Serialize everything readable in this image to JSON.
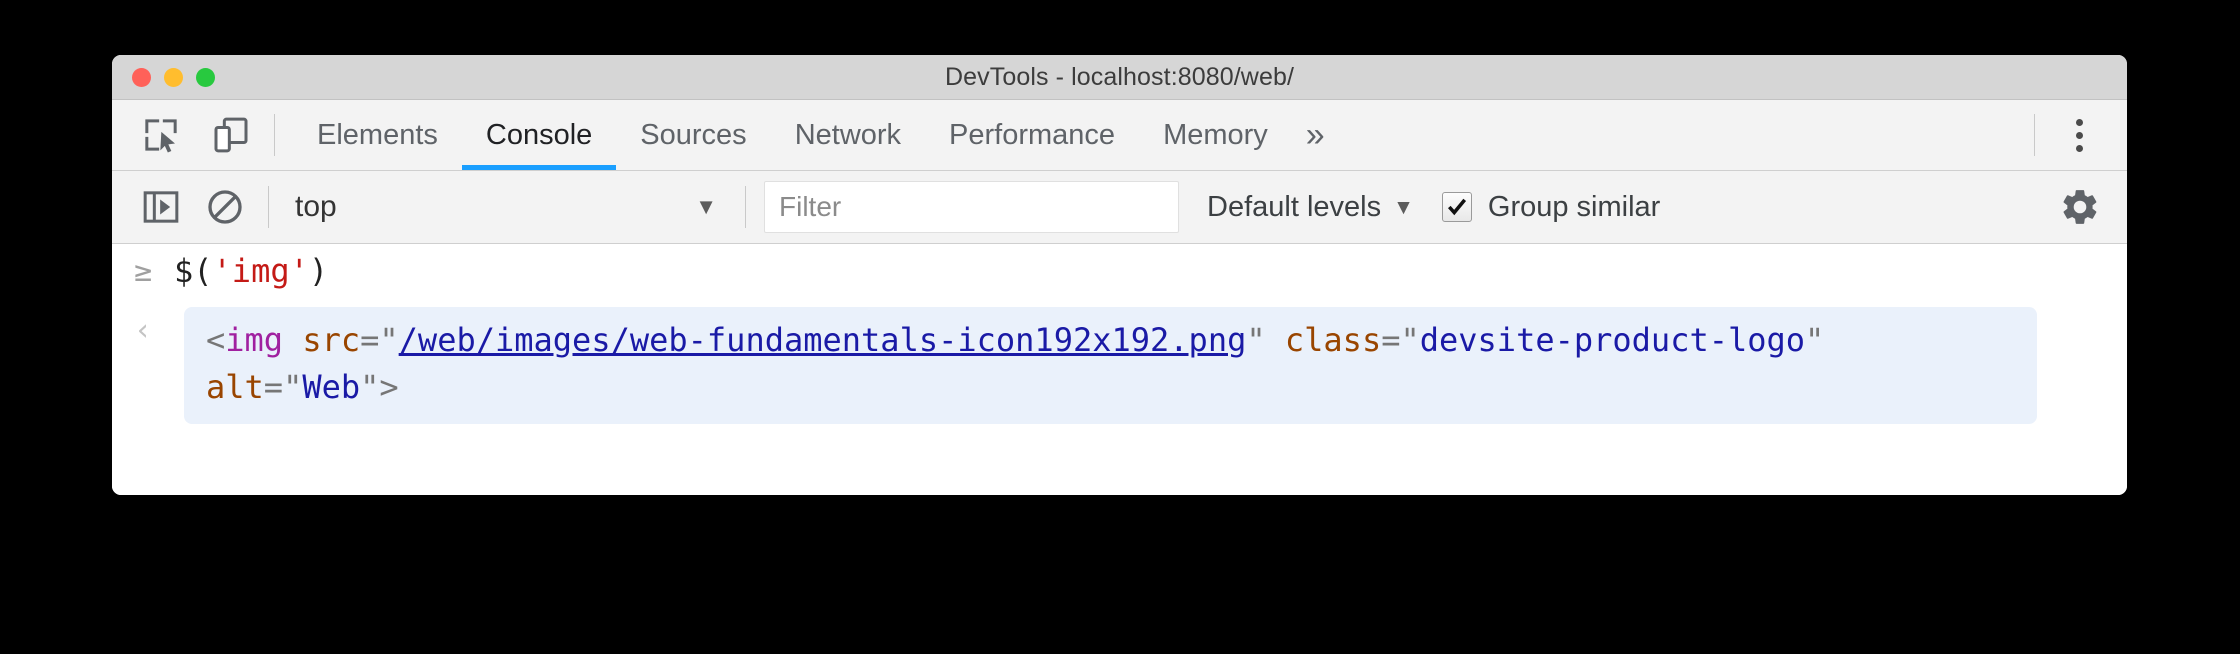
{
  "window": {
    "title": "DevTools - localhost:8080/web/",
    "traffic_lights": [
      {
        "name": "close",
        "color": "#ff6159"
      },
      {
        "name": "minimize",
        "color": "#ffbd2e"
      },
      {
        "name": "maximize",
        "color": "#28c93f"
      }
    ]
  },
  "toolbar_icons": {
    "inspect": "inspect-element-icon",
    "device": "device-toolbar-icon",
    "kebab": "more-options-icon"
  },
  "tabs": [
    {
      "label": "Elements",
      "active": false
    },
    {
      "label": "Console",
      "active": true
    },
    {
      "label": "Sources",
      "active": false
    },
    {
      "label": "Network",
      "active": false
    },
    {
      "label": "Performance",
      "active": false
    },
    {
      "label": "Memory",
      "active": false
    }
  ],
  "tab_overflow": "»",
  "console_toolbar": {
    "sidebar_toggle_icon": "console-sidebar-icon",
    "clear_icon": "clear-console-icon",
    "context_value": "top",
    "context_arrow": "▼",
    "filter_placeholder": "Filter",
    "filter_value": "",
    "levels_label": "Default levels",
    "levels_arrow": "▼",
    "group_similar_label": "Group similar",
    "group_similar_checked": true,
    "settings_icon": "gear-icon"
  },
  "console": {
    "prompt_glyph": "≥",
    "input_prefix": "$(",
    "input_string": "'img'",
    "input_suffix": ")",
    "result_glyph": "‹",
    "result": {
      "open": "<",
      "tag": "img",
      "space1": " ",
      "attr1_name": "src",
      "attr1_eq": "=",
      "quote": "\"",
      "attr1_value": "/web/images/web-fundamentals-icon192x192.png",
      "attr2_name": "class",
      "attr2_value": "devsite-product-logo",
      "attr3_name": "alt",
      "attr3_value": "Web",
      "close": ">"
    }
  },
  "colors": {
    "accent": "#1a9fff",
    "result_bg": "#eaf1fb",
    "string_red": "#c41a16",
    "tag_purple": "#a020a0",
    "attr_orange": "#994500",
    "value_blue": "#1a1aa6"
  }
}
